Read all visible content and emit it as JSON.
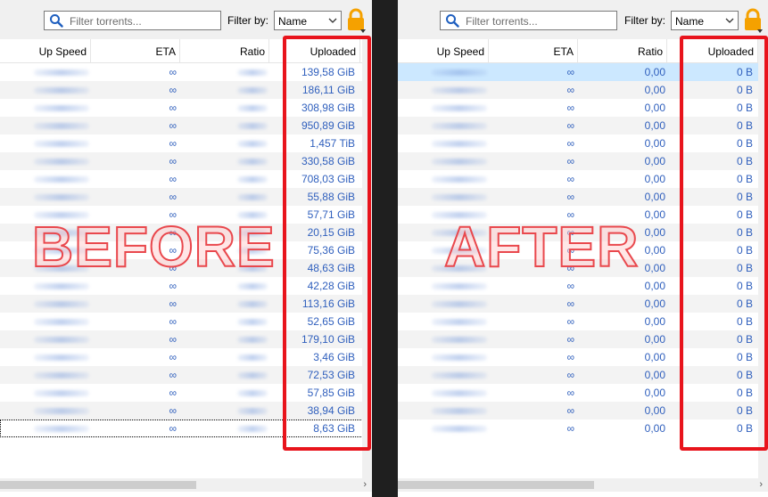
{
  "toolbar": {
    "search_placeholder": "Filter torrents...",
    "filter_label": "Filter by:",
    "filter_value": "Name"
  },
  "columns": {
    "up_speed": "Up Speed",
    "eta": "ETA",
    "ratio": "Ratio",
    "uploaded": "Uploaded"
  },
  "before": {
    "label": "BEFORE",
    "rows": [
      {
        "eta": "∞",
        "uploaded": "139,58 GiB"
      },
      {
        "eta": "∞",
        "uploaded": "186,11 GiB"
      },
      {
        "eta": "∞",
        "uploaded": "308,98 GiB"
      },
      {
        "eta": "∞",
        "uploaded": "950,89 GiB"
      },
      {
        "eta": "∞",
        "uploaded": "1,457 TiB"
      },
      {
        "eta": "∞",
        "uploaded": "330,58 GiB"
      },
      {
        "eta": "∞",
        "uploaded": "708,03 GiB"
      },
      {
        "eta": "∞",
        "uploaded": "55,88 GiB"
      },
      {
        "eta": "∞",
        "uploaded": "57,71 GiB"
      },
      {
        "eta": "∞",
        "uploaded": "20,15 GiB"
      },
      {
        "eta": "∞",
        "uploaded": "75,36 GiB"
      },
      {
        "eta": "∞",
        "uploaded": "48,63 GiB"
      },
      {
        "eta": "∞",
        "uploaded": "42,28 GiB"
      },
      {
        "eta": "∞",
        "uploaded": "113,16 GiB"
      },
      {
        "eta": "∞",
        "uploaded": "52,65 GiB"
      },
      {
        "eta": "∞",
        "uploaded": "179,10 GiB"
      },
      {
        "eta": "∞",
        "uploaded": "3,46 GiB"
      },
      {
        "eta": "∞",
        "uploaded": "72,53 GiB"
      },
      {
        "eta": "∞",
        "uploaded": "57,85 GiB"
      },
      {
        "eta": "∞",
        "uploaded": "38,94 GiB"
      },
      {
        "eta": "∞",
        "uploaded": "8,63 GiB"
      }
    ]
  },
  "after": {
    "label": "AFTER",
    "rows": [
      {
        "eta": "∞",
        "ratio": "0,00",
        "uploaded": "0 B"
      },
      {
        "eta": "∞",
        "ratio": "0,00",
        "uploaded": "0 B"
      },
      {
        "eta": "∞",
        "ratio": "0,00",
        "uploaded": "0 B"
      },
      {
        "eta": "∞",
        "ratio": "0,00",
        "uploaded": "0 B"
      },
      {
        "eta": "∞",
        "ratio": "0,00",
        "uploaded": "0 B"
      },
      {
        "eta": "∞",
        "ratio": "0,00",
        "uploaded": "0 B"
      },
      {
        "eta": "∞",
        "ratio": "0,00",
        "uploaded": "0 B"
      },
      {
        "eta": "∞",
        "ratio": "0,00",
        "uploaded": "0 B"
      },
      {
        "eta": "∞",
        "ratio": "0,00",
        "uploaded": "0 B"
      },
      {
        "eta": "∞",
        "ratio": "0,00",
        "uploaded": "0 B"
      },
      {
        "eta": "∞",
        "ratio": "0,00",
        "uploaded": "0 B"
      },
      {
        "eta": "∞",
        "ratio": "0,00",
        "uploaded": "0 B"
      },
      {
        "eta": "∞",
        "ratio": "0,00",
        "uploaded": "0 B"
      },
      {
        "eta": "∞",
        "ratio": "0,00",
        "uploaded": "0 B"
      },
      {
        "eta": "∞",
        "ratio": "0,00",
        "uploaded": "0 B"
      },
      {
        "eta": "∞",
        "ratio": "0,00",
        "uploaded": "0 B"
      },
      {
        "eta": "∞",
        "ratio": "0,00",
        "uploaded": "0 B"
      },
      {
        "eta": "∞",
        "ratio": "0,00",
        "uploaded": "0 B"
      },
      {
        "eta": "∞",
        "ratio": "0,00",
        "uploaded": "0 B"
      },
      {
        "eta": "∞",
        "ratio": "0,00",
        "uploaded": "0 B"
      },
      {
        "eta": "∞",
        "ratio": "0,00",
        "uploaded": "0 B"
      }
    ]
  },
  "icons": {
    "search": "search-icon",
    "dropdown": "chevron-down-icon",
    "lock": "lock-icon"
  },
  "colors": {
    "cell_text": "#2f5fbd",
    "highlight": "#e8141c",
    "selected_row": "#cce8ff",
    "lock": "#f5a100"
  }
}
